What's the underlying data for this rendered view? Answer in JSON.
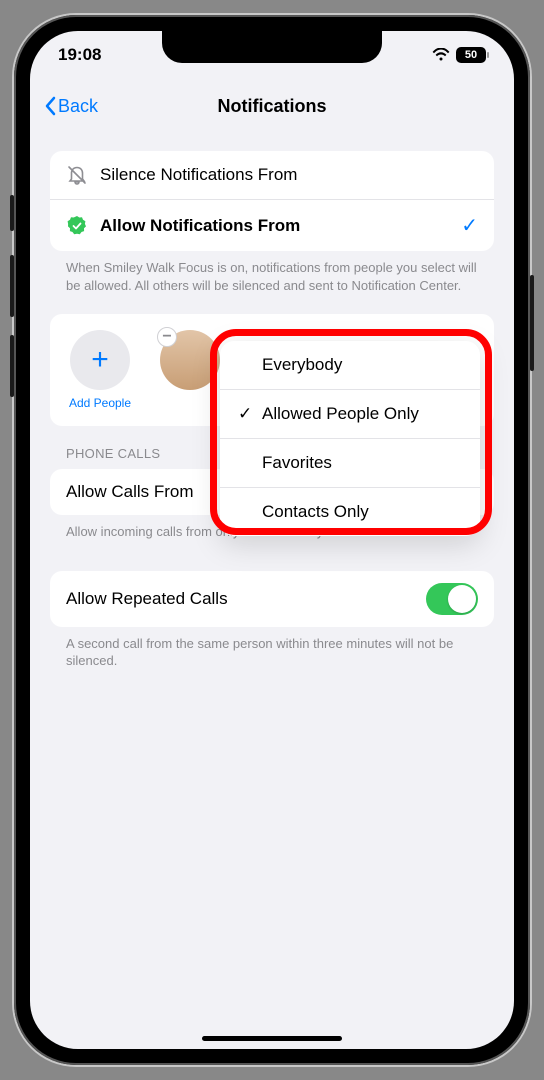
{
  "status": {
    "time": "19:08",
    "battery": "50"
  },
  "nav": {
    "back_label": "Back",
    "title": "Notifications"
  },
  "mode": {
    "silence_label": "Silence Notifications From",
    "allow_label": "Allow Notifications From",
    "footer": "When Smiley Walk Focus is on, notifications from people you select will be allowed. All others will be silenced and sent to Notification Center."
  },
  "people": {
    "add_label": "Add People"
  },
  "phone": {
    "header": "PHONE CALLS",
    "allow_from_label": "Allow Calls From",
    "allow_from_value": "Allowed People Only",
    "footer": "Allow incoming calls from only the contacts you added to the Focus."
  },
  "popup": {
    "items": [
      {
        "label": "Everybody",
        "checked": false
      },
      {
        "label": "Allowed People Only",
        "checked": true
      },
      {
        "label": "Favorites",
        "checked": false
      },
      {
        "label": "Contacts Only",
        "checked": false
      }
    ]
  },
  "repeated": {
    "label": "Allow Repeated Calls",
    "footer": "A second call from the same person within three minutes will not be silenced."
  }
}
